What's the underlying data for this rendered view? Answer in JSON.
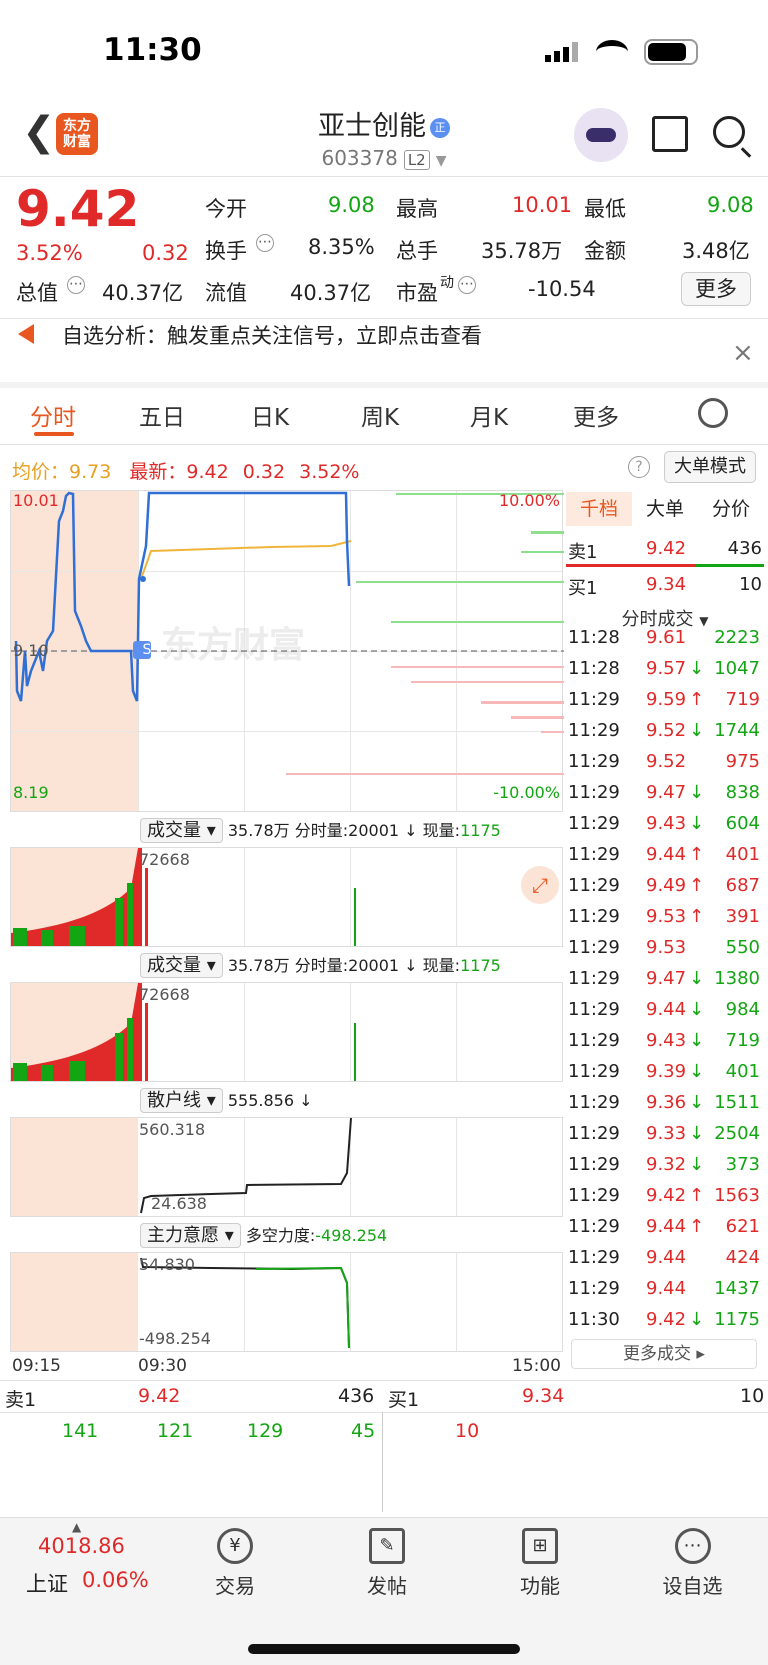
{
  "status_bar": {
    "time": "11:30"
  },
  "header": {
    "back_icon": "chevron-left-icon",
    "logo_line1": "东方",
    "logo_line2": "财富",
    "title": "亚士创能",
    "badge": "正",
    "code": "603378",
    "level": "L2"
  },
  "quote": {
    "price": "9.42",
    "pct": "3.52%",
    "chg": "0.32",
    "fields": [
      {
        "label": "今开",
        "value": "9.08",
        "color": "green"
      },
      {
        "label": "最高",
        "value": "10.01",
        "color": "red"
      },
      {
        "label": "最低",
        "value": "9.08",
        "color": "green"
      },
      {
        "label": "换手",
        "value": "8.35%",
        "color": "gray"
      },
      {
        "label": "总手",
        "value": "35.78万",
        "color": "gray"
      },
      {
        "label": "金额",
        "value": "3.48亿",
        "color": "gray"
      },
      {
        "label": "总值",
        "value": "40.37亿",
        "color": "gray"
      },
      {
        "label": "流值",
        "value": "40.37亿",
        "color": "gray"
      },
      {
        "label": "市盈",
        "label_sup": "动",
        "value": "-10.54",
        "color": "gray"
      }
    ],
    "more_label": "更多"
  },
  "notice": {
    "text": "自选分析：触发重点关注信号，立即点击查看",
    "close": "×"
  },
  "tabs": [
    "分时",
    "五日",
    "日K",
    "周K",
    "月K",
    "更多"
  ],
  "summary": {
    "avg_label": "均价：",
    "avg": "9.73",
    "latest_label": "最新：",
    "latest": "9.42",
    "chg": "0.32",
    "pct": "3.52%",
    "mode_btn": "大单模式"
  },
  "main_chart": {
    "y_high": "10.01",
    "y_low": "8.19",
    "pre_close": "9.10",
    "pct_high": "10.00%",
    "pct_low": "-10.00%",
    "watermark": "东方财富",
    "marker": "S"
  },
  "volume_panel": {
    "selector": "成交量",
    "total": "35.78万",
    "period_label": "分时量:",
    "period": "20001",
    "arrow": "↓",
    "now_label": "现量:",
    "now": "1175",
    "max": "72668"
  },
  "retail_panel": {
    "selector": "散户线",
    "value": "555.856",
    "arrow": "↓",
    "high": "560.318",
    "low": "24.638"
  },
  "main_force_panel": {
    "selector": "主力意愿",
    "label": "多空力度:",
    "value": "-498.254",
    "high": "54.830",
    "low": "-498.254"
  },
  "time_axis": [
    "09:15",
    "09:30",
    "15:00"
  ],
  "right_panel": {
    "tabs": [
      "千档",
      "大单",
      "分价"
    ],
    "sell1": {
      "label": "卖1",
      "price": "9.42",
      "vol": "436"
    },
    "buy1": {
      "label": "买1",
      "price": "9.34",
      "vol": "10"
    },
    "ticks_title": "分时成交",
    "ticks": [
      {
        "t": "11:28",
        "p": "9.61",
        "d": "",
        "v": "2223",
        "c": "red",
        "vc": "green"
      },
      {
        "t": "11:28",
        "p": "9.57",
        "d": "↓",
        "v": "1047",
        "c": "red",
        "vc": "green"
      },
      {
        "t": "11:29",
        "p": "9.59",
        "d": "↑",
        "v": "719",
        "c": "red",
        "vc": "red"
      },
      {
        "t": "11:29",
        "p": "9.52",
        "d": "↓",
        "v": "1744",
        "c": "red",
        "vc": "green"
      },
      {
        "t": "11:29",
        "p": "9.52",
        "d": "",
        "v": "975",
        "c": "red",
        "vc": "red"
      },
      {
        "t": "11:29",
        "p": "9.47",
        "d": "↓",
        "v": "838",
        "c": "red",
        "vc": "green"
      },
      {
        "t": "11:29",
        "p": "9.43",
        "d": "↓",
        "v": "604",
        "c": "red",
        "vc": "green"
      },
      {
        "t": "11:29",
        "p": "9.44",
        "d": "↑",
        "v": "401",
        "c": "red",
        "vc": "red"
      },
      {
        "t": "11:29",
        "p": "9.49",
        "d": "↑",
        "v": "687",
        "c": "red",
        "vc": "red"
      },
      {
        "t": "11:29",
        "p": "9.53",
        "d": "↑",
        "v": "391",
        "c": "red",
        "vc": "red"
      },
      {
        "t": "11:29",
        "p": "9.53",
        "d": "",
        "v": "550",
        "c": "red",
        "vc": "green"
      },
      {
        "t": "11:29",
        "p": "9.47",
        "d": "↓",
        "v": "1380",
        "c": "red",
        "vc": "green"
      },
      {
        "t": "11:29",
        "p": "9.44",
        "d": "↓",
        "v": "984",
        "c": "red",
        "vc": "green"
      },
      {
        "t": "11:29",
        "p": "9.43",
        "d": "↓",
        "v": "719",
        "c": "red",
        "vc": "green"
      },
      {
        "t": "11:29",
        "p": "9.39",
        "d": "↓",
        "v": "401",
        "c": "red",
        "vc": "green"
      },
      {
        "t": "11:29",
        "p": "9.36",
        "d": "↓",
        "v": "1511",
        "c": "red",
        "vc": "green"
      },
      {
        "t": "11:29",
        "p": "9.33",
        "d": "↓",
        "v": "2504",
        "c": "red",
        "vc": "green"
      },
      {
        "t": "11:29",
        "p": "9.32",
        "d": "↓",
        "v": "373",
        "c": "red",
        "vc": "green"
      },
      {
        "t": "11:29",
        "p": "9.42",
        "d": "↑",
        "v": "1563",
        "c": "red",
        "vc": "red"
      },
      {
        "t": "11:29",
        "p": "9.44",
        "d": "↑",
        "v": "621",
        "c": "red",
        "vc": "red"
      },
      {
        "t": "11:29",
        "p": "9.44",
        "d": "",
        "v": "424",
        "c": "red",
        "vc": "red"
      },
      {
        "t": "11:29",
        "p": "9.44",
        "d": "",
        "v": "1437",
        "c": "red",
        "vc": "green"
      },
      {
        "t": "11:30",
        "p": "9.42",
        "d": "↓",
        "v": "1175",
        "c": "red",
        "vc": "green"
      }
    ],
    "more": "更多成交"
  },
  "orderbook": {
    "sell": {
      "label": "卖1",
      "price": "9.42",
      "vol": "436",
      "queue": [
        "141",
        "121",
        "129",
        "45"
      ]
    },
    "buy": {
      "label": "买1",
      "price": "9.34",
      "vol": "10",
      "queue": [
        "10"
      ]
    }
  },
  "bottom_nav": {
    "index_value": "4018.86",
    "index_name": "上证",
    "index_pct": "0.06%",
    "items": [
      {
        "label": "交易",
        "icon": "yen-icon"
      },
      {
        "label": "发帖",
        "icon": "edit-icon"
      },
      {
        "label": "功能",
        "icon": "grid-icon"
      },
      {
        "label": "设自选",
        "icon": "more-dots-icon"
      }
    ]
  },
  "colors": {
    "accent": "#e8571f",
    "up": "#e02a2a",
    "down": "#13a513",
    "line": "#2f6fd6",
    "avg": "#f0b43a"
  }
}
